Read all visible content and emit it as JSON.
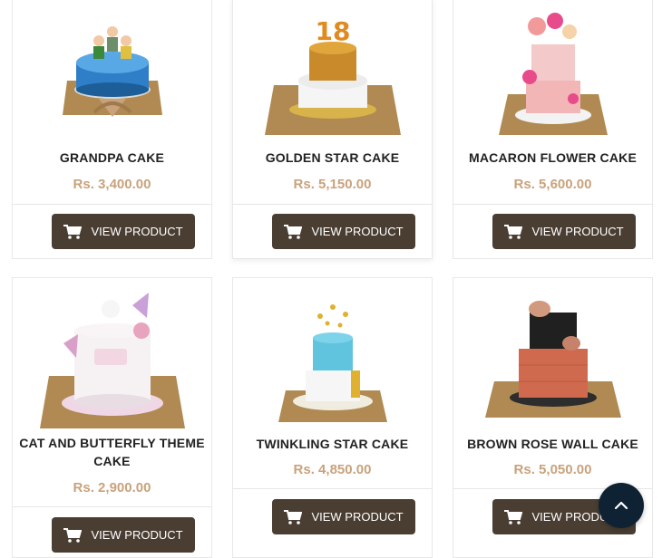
{
  "products": [
    {
      "name": "GRANDPA CAKE",
      "price": "Rs. 3,400.00",
      "button_label": "VIEW PRODUCT",
      "cake_icon": "grandpa-cake-image"
    },
    {
      "name": "GOLDEN STAR CAKE",
      "price": "Rs. 5,150.00",
      "button_label": "VIEW PRODUCT",
      "cake_icon": "golden-star-cake-image",
      "topper_text": "18"
    },
    {
      "name": "MACARON FLOWER CAKE",
      "price": "Rs. 5,600.00",
      "button_label": "VIEW PRODUCT",
      "cake_icon": "macaron-flower-cake-image"
    },
    {
      "name": "CAT AND BUTTERFLY THEME CAKE",
      "price": "Rs. 2,900.00",
      "button_label": "VIEW PRODUCT",
      "cake_icon": "cat-butterfly-cake-image"
    },
    {
      "name": "TWINKLING STAR CAKE",
      "price": "Rs. 4,850.00",
      "button_label": "VIEW PRODUCT",
      "cake_icon": "twinkling-star-cake-image"
    },
    {
      "name": "BROWN ROSE WALL CAKE",
      "price": "Rs. 5,050.00",
      "button_label": "VIEW PRODUCT",
      "cake_icon": "brown-rose-wall-cake-image"
    }
  ],
  "colors": {
    "price": "#c9a27c",
    "button_bg": "#4a3e33",
    "scroll_top_bg": "#0f2233"
  },
  "scroll_top_icon": "chevron-up-icon"
}
